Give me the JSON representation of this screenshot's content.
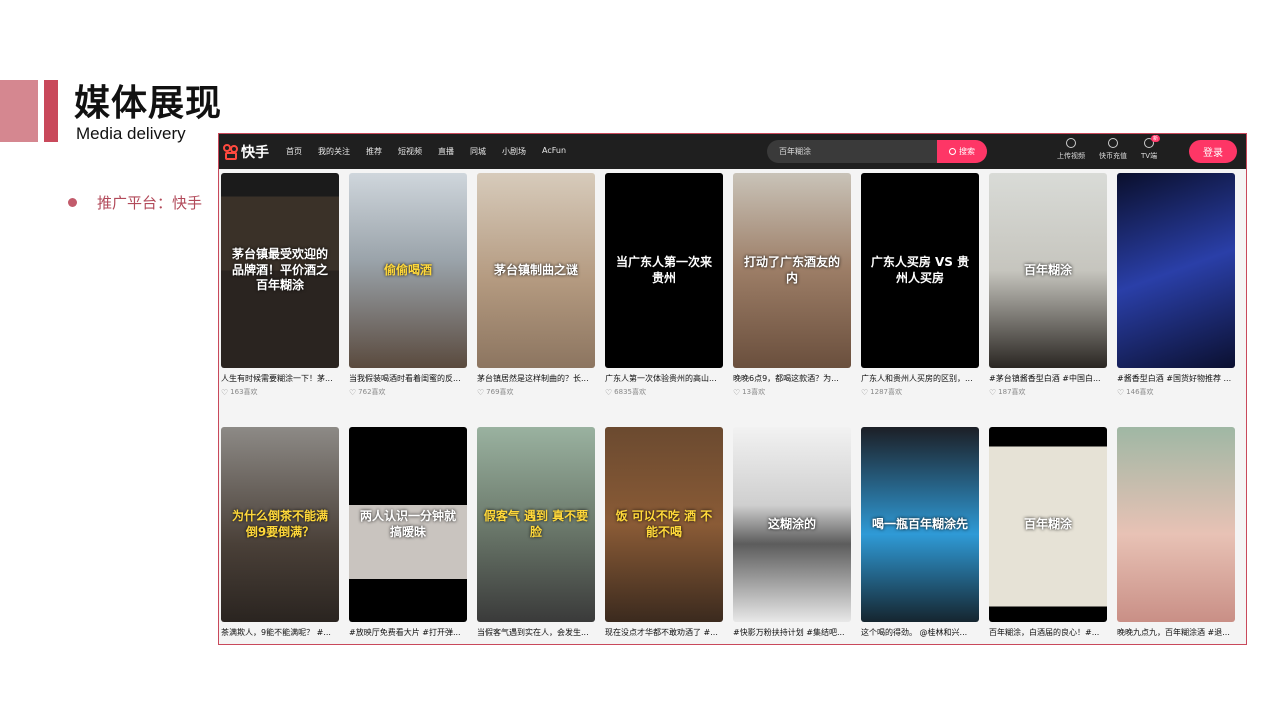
{
  "slide": {
    "title": "媒体展现",
    "subtitle": "Media delivery",
    "bullet": "推广平台：快手"
  },
  "colors": {
    "accent_pink": "#d58790",
    "accent_red": "#c9495b",
    "brand": "#fe3666"
  },
  "app": {
    "logo": "快手",
    "nav": [
      "首页",
      "我的关注",
      "推荐",
      "短视频",
      "直播",
      "同城",
      "小剧场",
      "AcFun"
    ],
    "search_value": "百年糊涂",
    "search_button": "搜索",
    "tools": [
      {
        "label": "上传视频",
        "icon": "upload-icon"
      },
      {
        "label": "快币充值",
        "icon": "coin-icon"
      },
      {
        "label": "TV端",
        "icon": "tv-icon",
        "badge": "新"
      }
    ],
    "login": "登录"
  },
  "cards": [
    {
      "overlay": "茅台镇最受欢迎的品牌酒！平价酒之百年糊涂",
      "title": "人生有时候需要糊涂一下！茅...",
      "likes": "163喜欢"
    },
    {
      "overlay": "偷偷喝酒",
      "title": "当我假装喝酒时看着闺蜜的反...",
      "likes": "762喜欢"
    },
    {
      "overlay": "茅台镇制曲之谜",
      "title": "茅台镇居然是这样制曲的？长...",
      "likes": "769喜欢"
    },
    {
      "overlay": "当广东人第一次来贵州",
      "title": "广东人第一次体验贵州的高山...",
      "likes": "6835喜欢"
    },
    {
      "overlay": "打动了广东酒友的内",
      "title": "晚晚6点9，都喝这款酒？为...",
      "likes": "13喜欢"
    },
    {
      "overlay": "广东人买房 VS 贵州人买房",
      "title": "广东人和贵州人买房的区别，...",
      "likes": "1287喜欢"
    },
    {
      "overlay": "百年糊涂",
      "title": "#茅台镇酱香型白酒 #中国白...",
      "likes": "187喜欢"
    },
    {
      "overlay": "",
      "title": "#酱香型白酒 #国货好物推荐 ...",
      "likes": "146喜欢"
    },
    {
      "overlay": "为什么倒茶不能满 倒9要倒满？",
      "title": "茶满欺人，9能不能满呢？ #...",
      "likes": ""
    },
    {
      "overlay": "两人认识一分钟就搞暧昧",
      "title": "#放映厅免费看大片 #打开弹...",
      "likes": ""
    },
    {
      "overlay": "假客气 遇到 真不要脸",
      "title": "当假客气遇到实在人，会发生...",
      "likes": ""
    },
    {
      "overlay": "饭 可以不吃 酒 不能不喝",
      "title": "现在没点才华都不敢劝酒了 #...",
      "likes": ""
    },
    {
      "overlay": "这糊涂的",
      "title": "#快影万粉扶持计划 #集结吧...",
      "likes": ""
    },
    {
      "overlay": "喝一瓶百年糊涂先",
      "title": "这个喝的得劲。 @桂林和兴...",
      "likes": ""
    },
    {
      "overlay": "百年糊涂",
      "title": "百年糊涂，白酒届的良心！#...",
      "likes": ""
    },
    {
      "overlay": "",
      "title": "晚晚九点九，百年糊涂酒 #退...",
      "likes": ""
    }
  ]
}
